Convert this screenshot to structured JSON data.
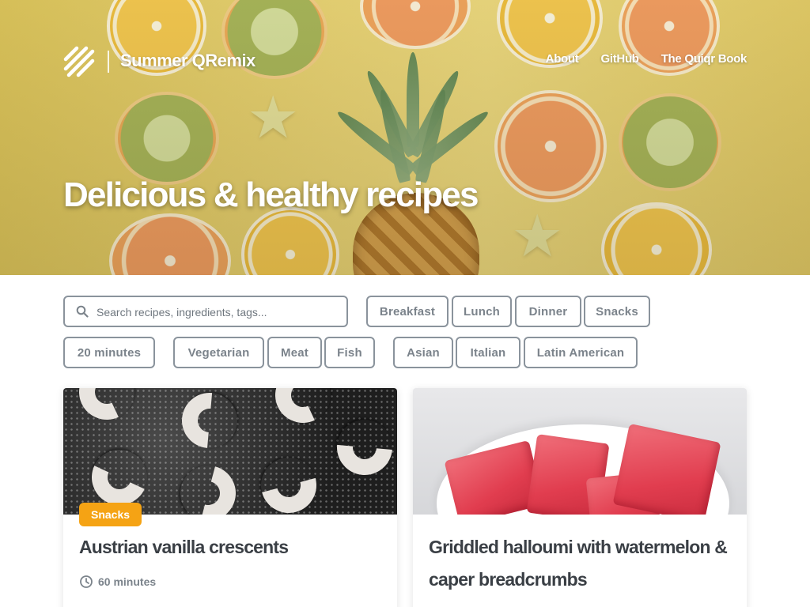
{
  "header": {
    "site_title": "Summer QRemix",
    "nav": [
      {
        "label": "About"
      },
      {
        "label": "GitHub"
      },
      {
        "label": "The Quiqr Book"
      }
    ],
    "hero_heading": "Delicious & healthy recipes"
  },
  "filters": {
    "search_placeholder": "Search recipes, ingredients, tags...",
    "search_value": "",
    "meal": [
      "Breakfast",
      "Lunch",
      "Dinner",
      "Snacks"
    ],
    "time": [
      "20 minutes"
    ],
    "diet": [
      "Vegetarian",
      "Meat",
      "Fish"
    ],
    "cuisine": [
      "Asian",
      "Italian",
      "Latin American"
    ]
  },
  "cards": [
    {
      "title": "Austrian vanilla crescents",
      "tag": "Snacks",
      "time": "60 minutes",
      "image": "vanilla-crescents-photo"
    },
    {
      "title_line1": "Griddled halloumi with watermelon &",
      "title_line2": "caper breadcrumbs",
      "image": "watermelon-photo"
    }
  ],
  "colors": {
    "accent_tag": "#f5a314",
    "chip_border": "#8a939c",
    "text": "#3a3f45",
    "muted": "#7b838b"
  },
  "icons": [
    "logo-icon",
    "search-icon",
    "clock-icon"
  ]
}
